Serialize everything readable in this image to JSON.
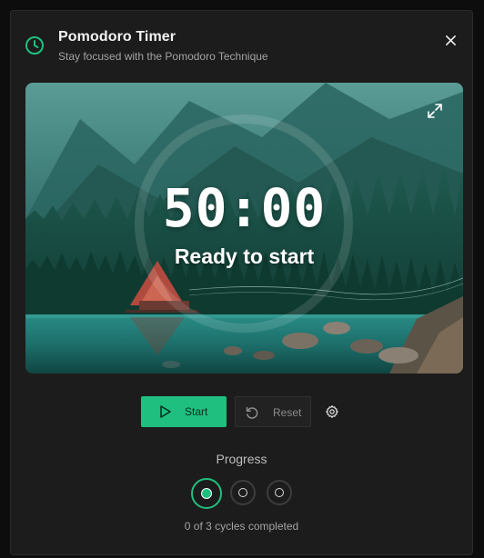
{
  "header": {
    "title": "Pomodoro Timer",
    "subtitle": "Stay focused with the Pomodoro Technique",
    "icon": "clock-icon",
    "close_icon": "close-icon"
  },
  "timer": {
    "display": "50:00",
    "status": "Ready to start",
    "expand_icon": "expand-icon"
  },
  "controls": {
    "start_label": "Start",
    "start_icon": "play-icon",
    "reset_label": "Reset",
    "reset_icon": "reset-icon",
    "settings_icon": "gear-icon"
  },
  "progress": {
    "title": "Progress",
    "completed": 0,
    "total": 3,
    "summary": "0 of 3 cycles completed"
  },
  "colors": {
    "accent": "#1fbf7f",
    "background": "#1c1c1c",
    "page": "#0d0d0d"
  }
}
